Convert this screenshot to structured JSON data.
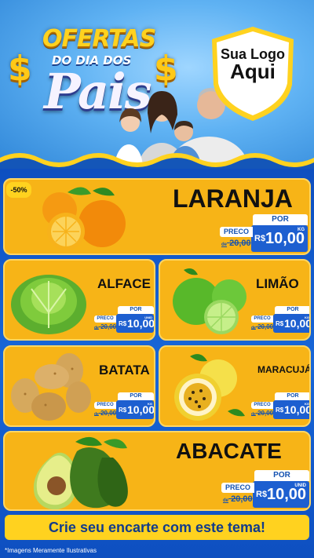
{
  "header": {
    "title_line1": "OFERTAS",
    "title_line2": "DO DIA DOS",
    "title_line3": "Pais",
    "dollar_sign": "$"
  },
  "logo": {
    "line1": "Sua Logo",
    "line2": "Aqui"
  },
  "discount_badge": "-50%",
  "products": [
    {
      "name": "LARANJA",
      "price_label": "PRECO",
      "old_price": "20,00",
      "old_prefix": "de",
      "por_label": "POR",
      "currency": "R$",
      "price": "10,00",
      "unit": "KG"
    },
    {
      "name": "ALFACE",
      "price_label": "PRECO",
      "old_price": "20,00",
      "old_prefix": "de",
      "por_label": "POR",
      "currency": "R$",
      "price": "10,00",
      "unit": "UNID"
    },
    {
      "name": "LIMÃO",
      "price_label": "PRECO",
      "old_price": "20,00",
      "old_prefix": "de",
      "por_label": "POR",
      "currency": "R$",
      "price": "10,00",
      "unit": "KG"
    },
    {
      "name": "BATATA",
      "price_label": "PRECO",
      "old_price": "20,00",
      "old_prefix": "de",
      "por_label": "POR",
      "currency": "R$",
      "price": "10,00",
      "unit": "KG"
    },
    {
      "name": "MARACUJÁ",
      "price_label": "PRECO",
      "old_price": "20,00",
      "old_prefix": "de",
      "por_label": "POR",
      "currency": "R$",
      "price": "10,00",
      "unit": "KG"
    },
    {
      "name": "ABACATE",
      "price_label": "PRECO",
      "old_price": "20,00",
      "old_prefix": "de",
      "por_label": "POR",
      "currency": "R$",
      "price": "10,00",
      "unit": "UNID"
    }
  ],
  "cta": "Crie seu encarte com este tema!",
  "footnote": "*Imagens Meramente Ilustrativas",
  "colors": {
    "card_yellow": "#f7b417",
    "panel_blue": "#1456b8",
    "price_blue": "#1d5fd0"
  }
}
